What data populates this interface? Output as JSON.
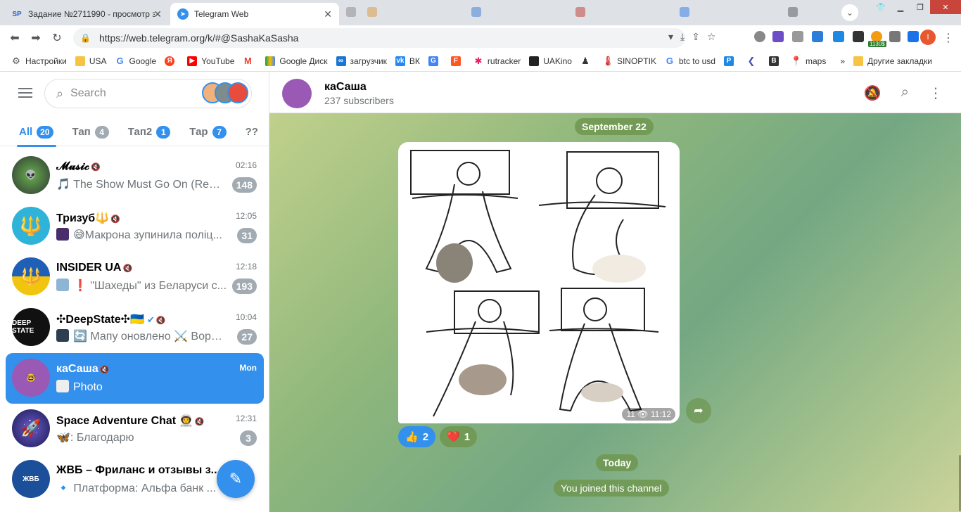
{
  "browser": {
    "tabs": [
      {
        "title": "Задание №2711990 - просмотр з",
        "favicon": "SP"
      },
      {
        "title": "Telegram Web"
      }
    ],
    "url": "https://web.telegram.org/k/#@SashaKaSasha",
    "ext_badge": "1130$",
    "bookmarks": [
      "Настройки",
      "USA",
      "Google",
      "YouTube",
      "Google Диск",
      "загрузчик",
      "ВК",
      "rutracker",
      "UAKino",
      "SINOPTIK",
      "btc to usd",
      "maps"
    ],
    "bookmarks_overflow": "»",
    "other_bookmarks": "Другие закладки"
  },
  "sidebar": {
    "search_placeholder": "Search",
    "filters": [
      {
        "label": "All",
        "count": "20"
      },
      {
        "label": "Тап",
        "count": "4"
      },
      {
        "label": "Тап2",
        "count": "1"
      },
      {
        "label": "Тар",
        "count": "7"
      },
      {
        "label": "??",
        "count": ""
      }
    ],
    "chats": [
      {
        "title": "𝓜𝓾𝓼𝓲𝓬",
        "time": "02:16",
        "preview": "🎵 The Show Must Go On (Rem...",
        "badge": "148",
        "avatar_color": "#3b4a2e"
      },
      {
        "title": "Тризуб🔱",
        "time": "12:05",
        "preview": "😅Макрона зупинила поліц...",
        "badge": "31",
        "avatar_color": "#2fb3d9"
      },
      {
        "title": "INSIDER UA",
        "time": "12:18",
        "preview": "❗ \"Шахеды\" из Беларуси с...",
        "badge": "193",
        "avatar_color": "#1f5fb5"
      },
      {
        "title": "✣DeepState✣🇺🇦",
        "time": "10:04",
        "preview": "🔄 Мапу оновлено ⚔️ Воро...",
        "badge": "27",
        "avatar_color": "#111111"
      },
      {
        "title": "каСаша",
        "time": "Mon",
        "preview": "Photo",
        "badge": "",
        "avatar_color": "#9b59b6"
      },
      {
        "title": "Space Adventure Chat 👨‍🚀",
        "time": "12:31",
        "preview": "🦋: Благодарю",
        "badge": "3",
        "avatar_color": "#2c2a6b"
      },
      {
        "title": "ЖВБ – Фриланс и отзывы з...",
        "time": "",
        "preview": "🔹 Платформа: Альфа банк ...",
        "badge": "",
        "avatar_color": "#1b4f9a"
      }
    ]
  },
  "channel": {
    "name": "каСаша",
    "subscribers": "237 subscribers",
    "date_pill": "September 22",
    "views": "11",
    "time": "11:12",
    "reactions": [
      {
        "emoji": "👍",
        "count": "2"
      },
      {
        "emoji": "❤️",
        "count": "1"
      }
    ],
    "today_pill": "Today",
    "joined_pill": "You joined this channel"
  }
}
